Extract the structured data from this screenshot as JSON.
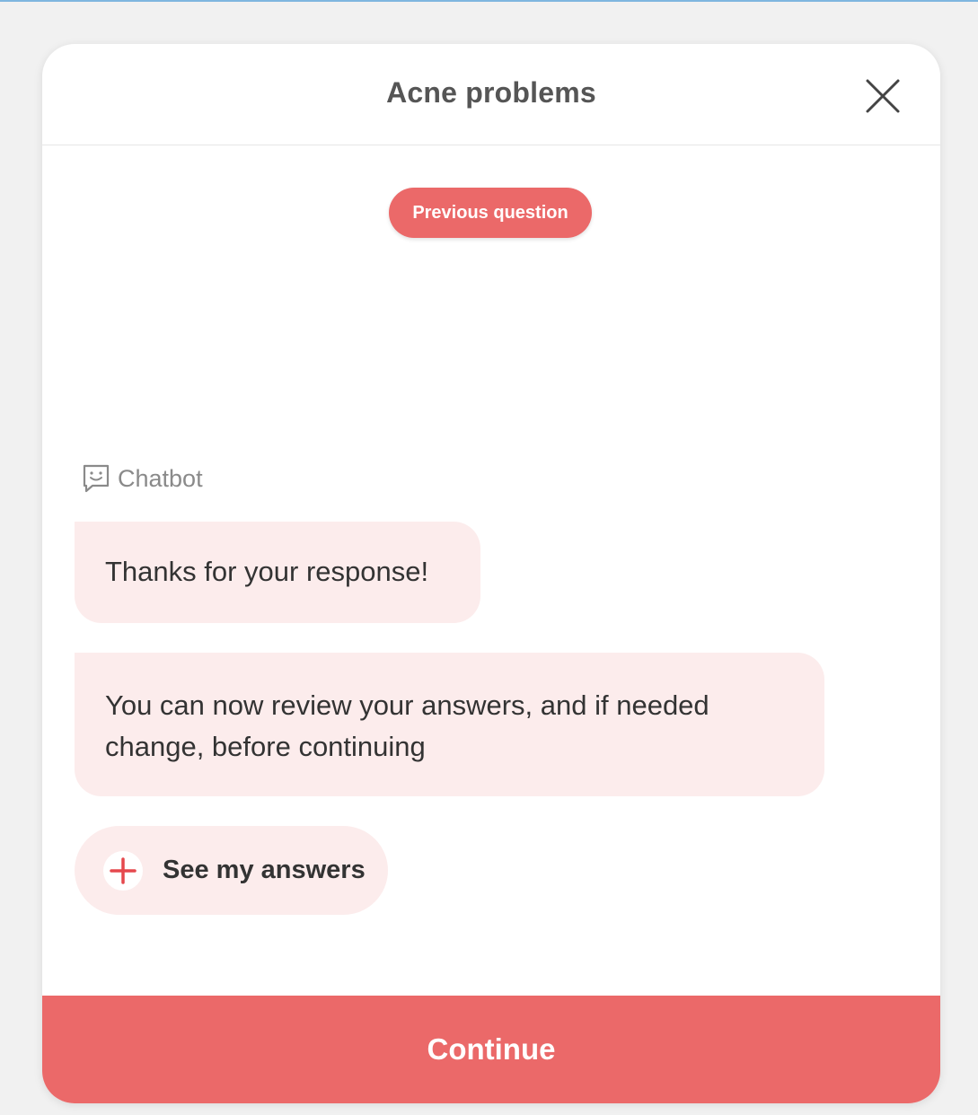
{
  "header": {
    "title": "Acne problems",
    "close_icon": "close-icon"
  },
  "previous_question": {
    "label": "Previous question"
  },
  "chatbot": {
    "label": "Chatbot",
    "icon": "chatbot-face-icon",
    "messages": [
      "Thanks for your response!",
      "You can now review your answers, and if needed change, before continuing"
    ]
  },
  "see_answers": {
    "label": "See my answers",
    "icon": "plus-icon"
  },
  "footer": {
    "continue_label": "Continue"
  },
  "colors": {
    "accent": "#eb6969",
    "bubble_bg": "#fcecec",
    "background": "#f1f1f1"
  }
}
